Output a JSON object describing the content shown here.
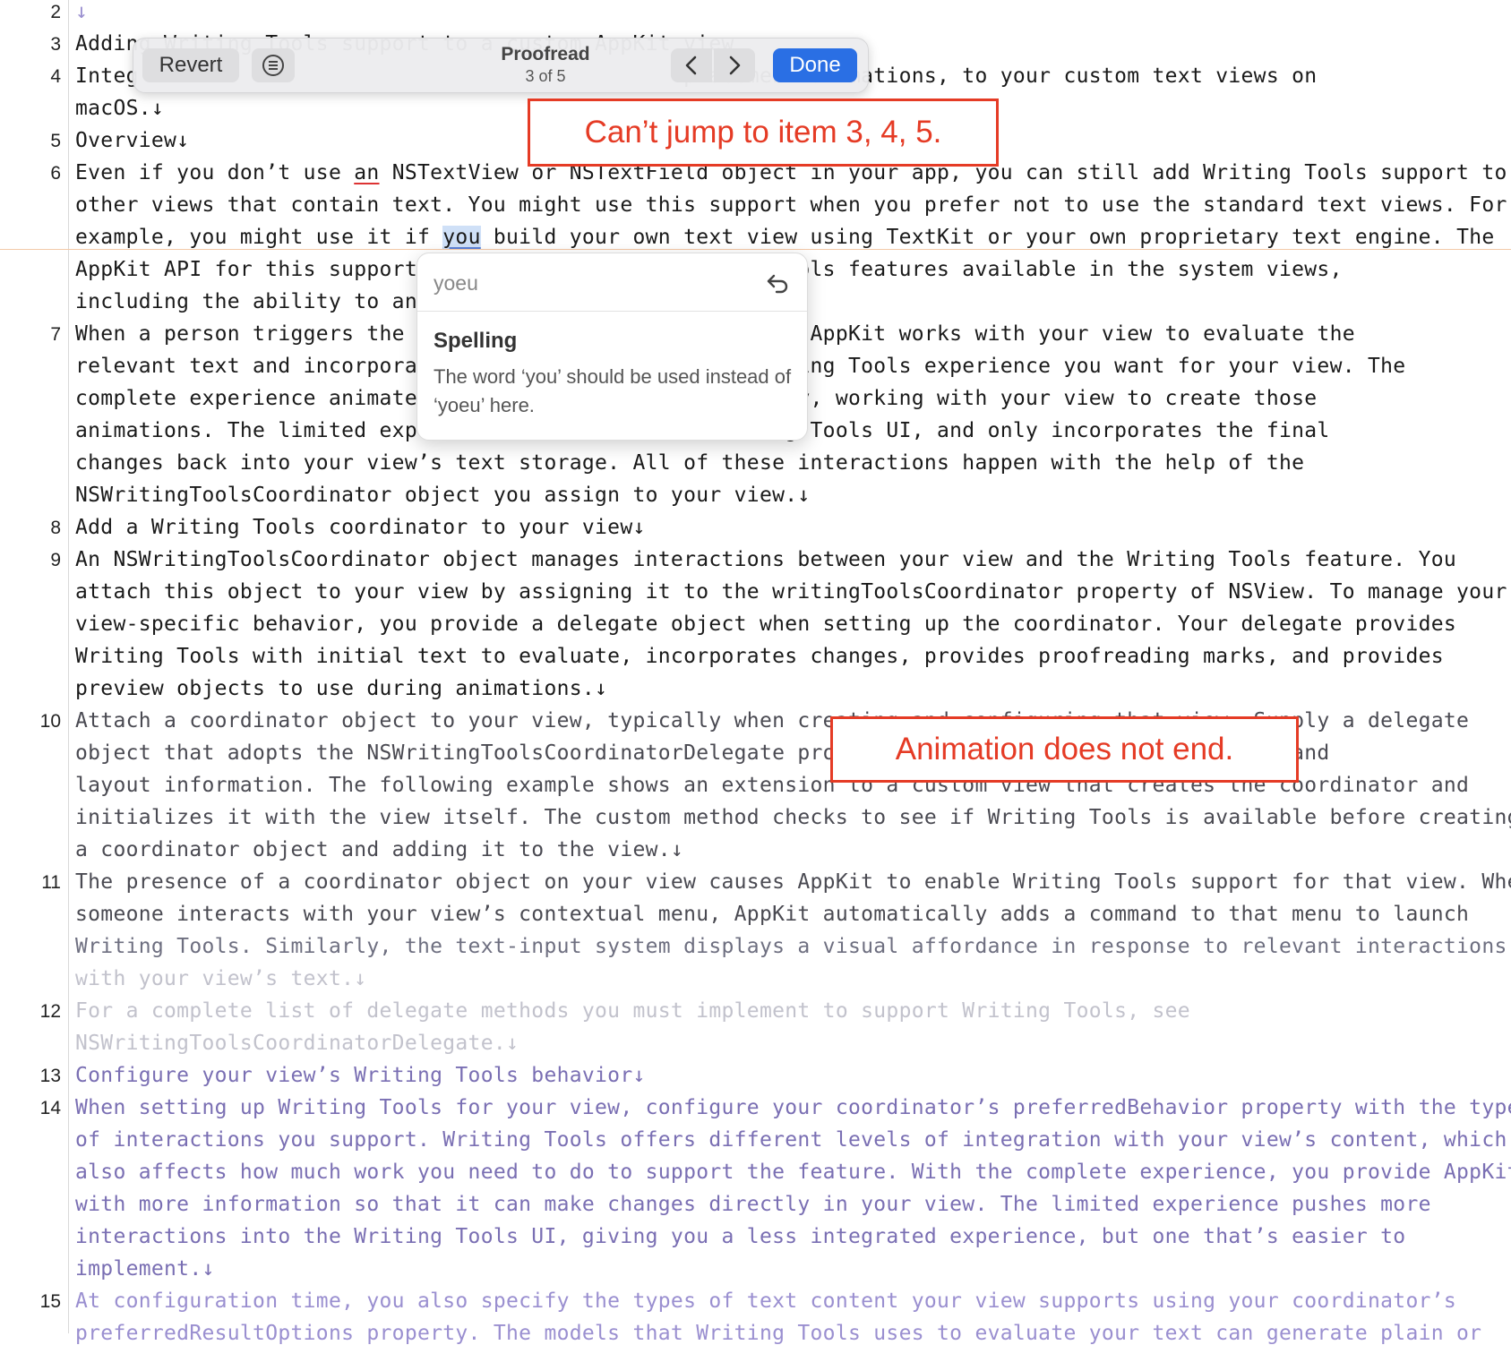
{
  "editor": {
    "lines": [
      {
        "num": "2",
        "text": "↓",
        "tone": "c5"
      },
      {
        "num": "3",
        "text": "Adding Writing Tools support to a custom AppKit view",
        "tone": "c0"
      },
      {
        "num": "4",
        "text": "Integ                                           placement animations, to your custom text views on",
        "tone": "c0"
      },
      {
        "num": "",
        "text": "macOS.↓",
        "tone": "c0"
      },
      {
        "num": "5",
        "text": "Overview↓",
        "tone": "c0"
      },
      {
        "num": "6",
        "text": "Even if you don’t use an NSTextView or NSTextField object in your app, you can still add Writing Tools support to",
        "tone": "c0"
      },
      {
        "num": "",
        "text": "other views that contain text. You might use this support when you prefer not to use the standard text views. For",
        "tone": "c0"
      },
      {
        "num": "",
        "text": "example, you might use it if you build your own text view using TextKit or your own proprietary text engine. The",
        "tone": "c0"
      },
      {
        "num": "",
        "text": "AppKit API for this support                      iting Tools features available in the system views,",
        "tone": "c0"
      },
      {
        "num": "",
        "text": "including the ability to ani                     r view.↓",
        "tone": "c0"
      },
      {
        "num": "7",
        "text": "When a person triggers the W                      n view, AppKit works with your view to evaluate the",
        "tone": "c0"
      },
      {
        "num": "",
        "text": "relevant text and incorporat                      of Writing Tools experience you want for your view. The",
        "tone": "c0"
      },
      {
        "num": "",
        "text": "complete experience animates                      directly, working with your view to create those",
        "tone": "c0"
      },
      {
        "num": "",
        "text": "animations. The limited expe                      Writing Tools UI, and only incorporates the final",
        "tone": "c0"
      },
      {
        "num": "",
        "text": "changes back into your view’s text storage. All of these interactions happen with the help of the",
        "tone": "c0"
      },
      {
        "num": "",
        "text": "NSWritingToolsCoordinator object you assign to your view.↓",
        "tone": "c0"
      },
      {
        "num": "8",
        "text": "Add a Writing Tools coordinator to your view↓",
        "tone": "c0"
      },
      {
        "num": "9",
        "text": "An NSWritingToolsCoordinator object manages interactions between your view and the Writing Tools feature. You",
        "tone": "c0"
      },
      {
        "num": "",
        "text": "attach this object to your view by assigning it to the writingToolsCoordinator property of NSView. To manage your",
        "tone": "c0"
      },
      {
        "num": "",
        "text": "view-specific behavior, you provide a delegate object when setting up the coordinator. Your delegate provides",
        "tone": "c0"
      },
      {
        "num": "",
        "text": "Writing Tools with initial text to evaluate, incorporates changes, provides proofreading marks, and provides",
        "tone": "c0"
      },
      {
        "num": "",
        "text": "preview objects to use during animations.↓",
        "tone": "c0"
      },
      {
        "num": "10",
        "text": "Attach a coordinator object to your view, typically when creating and configuring that view. Supply a delegate",
        "tone": "c1"
      },
      {
        "num": "",
        "text": "object that adopts the NSWritingToolsCoordinatorDelegate protocol to manage the current content and",
        "tone": "c1"
      },
      {
        "num": "",
        "text": "layout information. The following example shows an extension to a custom view that creates the coordinator and",
        "tone": "c1"
      },
      {
        "num": "",
        "text": "initializes it with the view itself. The custom method checks to see if Writing Tools is available before creating",
        "tone": "c1"
      },
      {
        "num": "",
        "text": "a coordinator object and adding it to the view.↓",
        "tone": "c1"
      },
      {
        "num": "11",
        "text": "The presence of a coordinator object on your view causes AppKit to enable Writing Tools support for that view. When",
        "tone": "c1"
      },
      {
        "num": "",
        "text": "someone interacts with your view’s contextual menu, AppKit automatically adds a command to that menu to launch",
        "tone": "c1"
      },
      {
        "num": "",
        "text": "Writing Tools. Similarly, the text-input system displays a visual affordance in response to relevant interactions",
        "tone": "c2"
      },
      {
        "num": "",
        "text": "with your view’s text.↓",
        "tone": "c3"
      },
      {
        "num": "12",
        "text": "For a complete list of delegate methods you must implement to support Writing Tools, see",
        "tone": "c3"
      },
      {
        "num": "",
        "text": "NSWritingToolsCoordinatorDelegate.↓",
        "tone": "c3"
      },
      {
        "num": "13",
        "text": "Configure your view’s Writing Tools behavior↓",
        "tone": "c4"
      },
      {
        "num": "14",
        "text": "When setting up Writing Tools for your view, configure your coordinator’s preferredBehavior property with the types",
        "tone": "c4"
      },
      {
        "num": "",
        "text": "of interactions you support. Writing Tools offers different levels of integration with your view’s content, which",
        "tone": "c4"
      },
      {
        "num": "",
        "text": "also affects how much work you need to do to support the feature. With the complete experience, you provide AppKit",
        "tone": "c4"
      },
      {
        "num": "",
        "text": "with more information so that it can make changes directly in your view. The limited experience pushes more",
        "tone": "c4"
      },
      {
        "num": "",
        "text": "interactions into the Writing Tools UI, giving you a less integrated experience, but one that’s easier to",
        "tone": "c4"
      },
      {
        "num": "",
        "text": "implement.↓",
        "tone": "c4"
      },
      {
        "num": "15",
        "text": "At configuration time, you also specify the types of text content your view supports using your coordinator’s",
        "tone": "c5"
      },
      {
        "num": "",
        "text": "preferredResultOptions property. The models that Writing Tools uses to evaluate your text can generate plain or",
        "tone": "c5"
      }
    ]
  },
  "toolbar": {
    "revert_label": "Revert",
    "title": "Proofread",
    "position": "3 of 5",
    "done_label": "Done",
    "menu_icon": "list-circle-icon",
    "prev_icon": "chevron-left-icon",
    "next_icon": "chevron-right-icon"
  },
  "popover": {
    "original_word": "yoeu",
    "undo_icon": "undo-arrow-icon",
    "heading": "Spelling",
    "body": "The word ‘you’ should be used instead of ‘yoeu’ here."
  },
  "annotations": {
    "note1": "Can’t jump to item 3, 4, 5.",
    "note2": "Animation does not end."
  },
  "colors": {
    "accent": "#2a6fe4",
    "annotation": "#e53b25",
    "misspelling_underline": "#dd3333",
    "selection": "#cfe0f7"
  }
}
